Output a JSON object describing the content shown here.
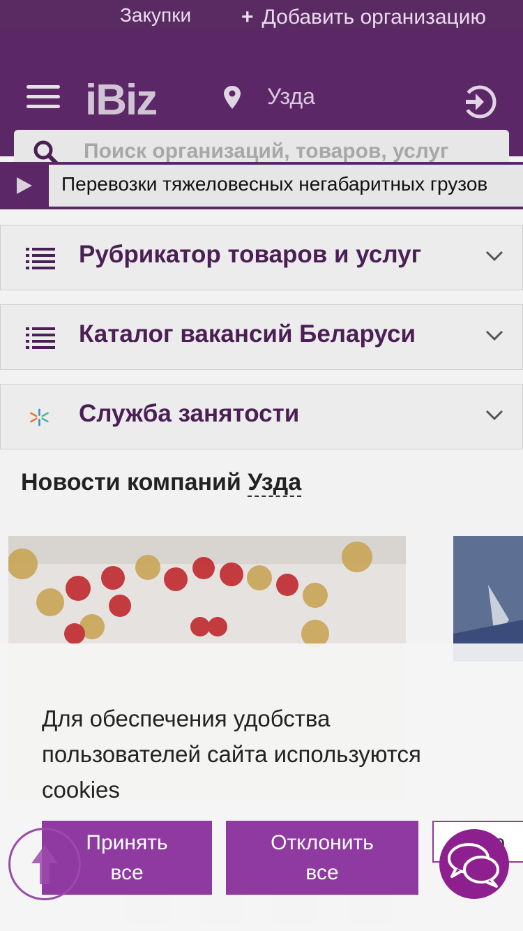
{
  "topbar": {
    "zakupki": "Закупки",
    "add_org": "Добавить организацию"
  },
  "header": {
    "logo": "iBiz",
    "city": "Узда"
  },
  "search": {
    "placeholder": "Поиск организаций, товаров, услуг"
  },
  "ticker": {
    "text": "Перевозки тяжеловесных негабаритных грузов"
  },
  "panels": [
    {
      "label": "Рубрикатор товаров и услуг",
      "icon": "list-icon"
    },
    {
      "label": "Каталог вакансий Беларуси",
      "icon": "list-icon"
    },
    {
      "label": "Служба занятости",
      "icon": "employment-service-icon"
    }
  ],
  "news": {
    "title": "Новости компаний",
    "city": "Узда"
  },
  "cookie": {
    "text": "Для обеспечения удобства пользователей сайта используются cookies",
    "accept_line1": "Принять",
    "accept_line2": "все",
    "decline_line1": "Отклонить",
    "decline_line2": "все",
    "more": "др"
  },
  "colors": {
    "brand": "#5b2766",
    "accent": "#8e3aa0",
    "chat": "#8e1f8e"
  }
}
